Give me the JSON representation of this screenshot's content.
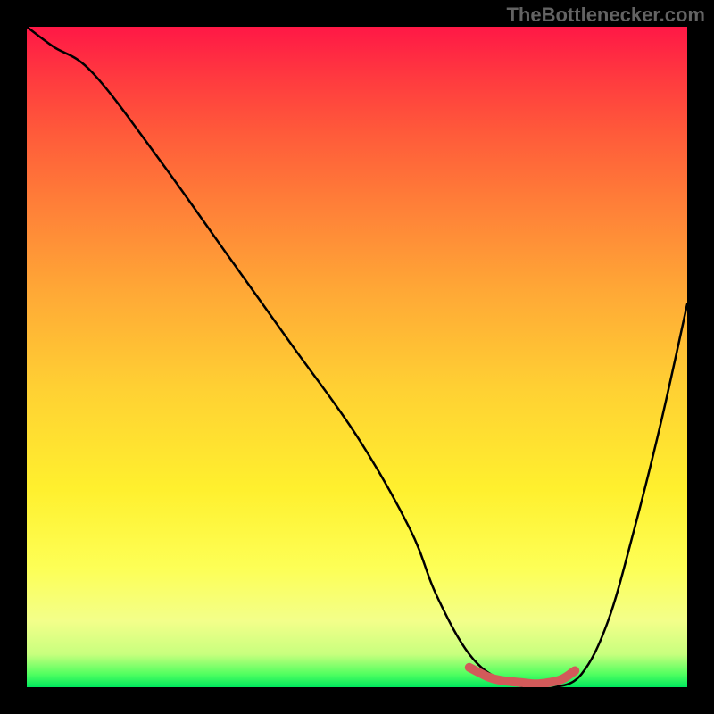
{
  "watermark": "TheBottlenecker.com",
  "chart_data": {
    "type": "line",
    "title": "",
    "xlabel": "",
    "ylabel": "",
    "xlim": [
      0,
      100
    ],
    "ylim": [
      0,
      100
    ],
    "series": [
      {
        "name": "bottleneck-curve",
        "color": "#000000",
        "x": [
          0,
          4,
          10,
          20,
          30,
          40,
          50,
          58,
          62,
          67,
          72,
          77,
          80,
          84,
          88,
          92,
          96,
          100
        ],
        "values": [
          100,
          97,
          93,
          80,
          66,
          52,
          38,
          24,
          14,
          5,
          1,
          0,
          0,
          2,
          10,
          24,
          40,
          58
        ]
      },
      {
        "name": "highlight-segment",
        "color": "#d25a5a",
        "x": [
          67,
          70,
          72,
          75,
          77,
          79,
          81,
          83
        ],
        "values": [
          3,
          1.5,
          1,
          0.7,
          0.5,
          0.7,
          1.2,
          2.5
        ]
      }
    ],
    "gradient_stops": [
      {
        "pct": 0,
        "color": "#ff1846"
      },
      {
        "pct": 8,
        "color": "#ff3b3f"
      },
      {
        "pct": 16,
        "color": "#ff5a3a"
      },
      {
        "pct": 26,
        "color": "#ff7c38"
      },
      {
        "pct": 40,
        "color": "#ffa836"
      },
      {
        "pct": 55,
        "color": "#ffd133"
      },
      {
        "pct": 70,
        "color": "#fff02e"
      },
      {
        "pct": 82,
        "color": "#fdff56"
      },
      {
        "pct": 90,
        "color": "#f3ff8a"
      },
      {
        "pct": 95,
        "color": "#c8ff7e"
      },
      {
        "pct": 98,
        "color": "#52ff60"
      },
      {
        "pct": 100,
        "color": "#00e85e"
      }
    ]
  }
}
